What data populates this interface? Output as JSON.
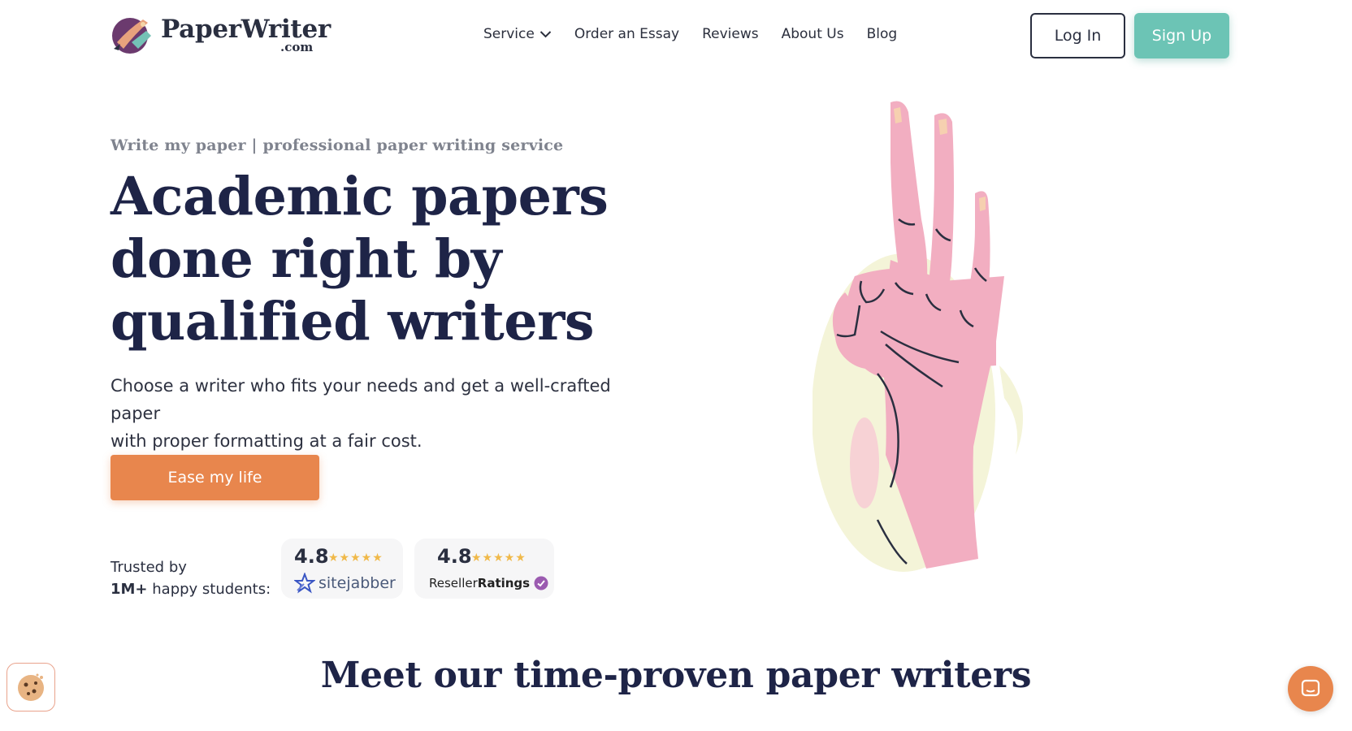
{
  "header": {
    "logo_name": "PaperWriter",
    "logo_domain": ".com",
    "nav": [
      {
        "label": "Service"
      },
      {
        "label": "Order an Essay"
      },
      {
        "label": "Reviews"
      },
      {
        "label": "About Us"
      },
      {
        "label": "Blog"
      }
    ],
    "login_label": "Log In",
    "signup_label": "Sign Up"
  },
  "hero": {
    "eyebrow": "Write my paper | professional paper writing service",
    "headline": [
      "Academic papers",
      "done right by",
      "qualified writers"
    ],
    "subtext_line1": "Choose a writer who fits your needs and get a well-crafted paper",
    "subtext_line2": "with proper formatting at a fair cost.",
    "cta_label": "Ease my life",
    "trusted_line1": "Trusted by",
    "trusted_bold": "1M+",
    "trusted_rest": " happy students:",
    "ratings": [
      {
        "score": "4.8",
        "stars": 4.8,
        "source": "sitejabber"
      },
      {
        "score": "4.8",
        "stars": 4.8,
        "source_prefix": "Reseller",
        "source_bold": "Ratings"
      }
    ]
  },
  "section": {
    "title": "Meet our time-proven paper writers"
  },
  "colors": {
    "brand_navy": "#1e2447",
    "accent_orange": "#e8864d",
    "accent_teal": "#6cc4b5",
    "hand_pink": "#f2aec1",
    "circle_yellow": "#f4f4d8"
  },
  "icons": {
    "logo": "quill-pen-logo-icon",
    "service_dropdown": "chevron-down-icon",
    "cookie": "cookie-icon",
    "chat": "chat-bubble-icon"
  }
}
